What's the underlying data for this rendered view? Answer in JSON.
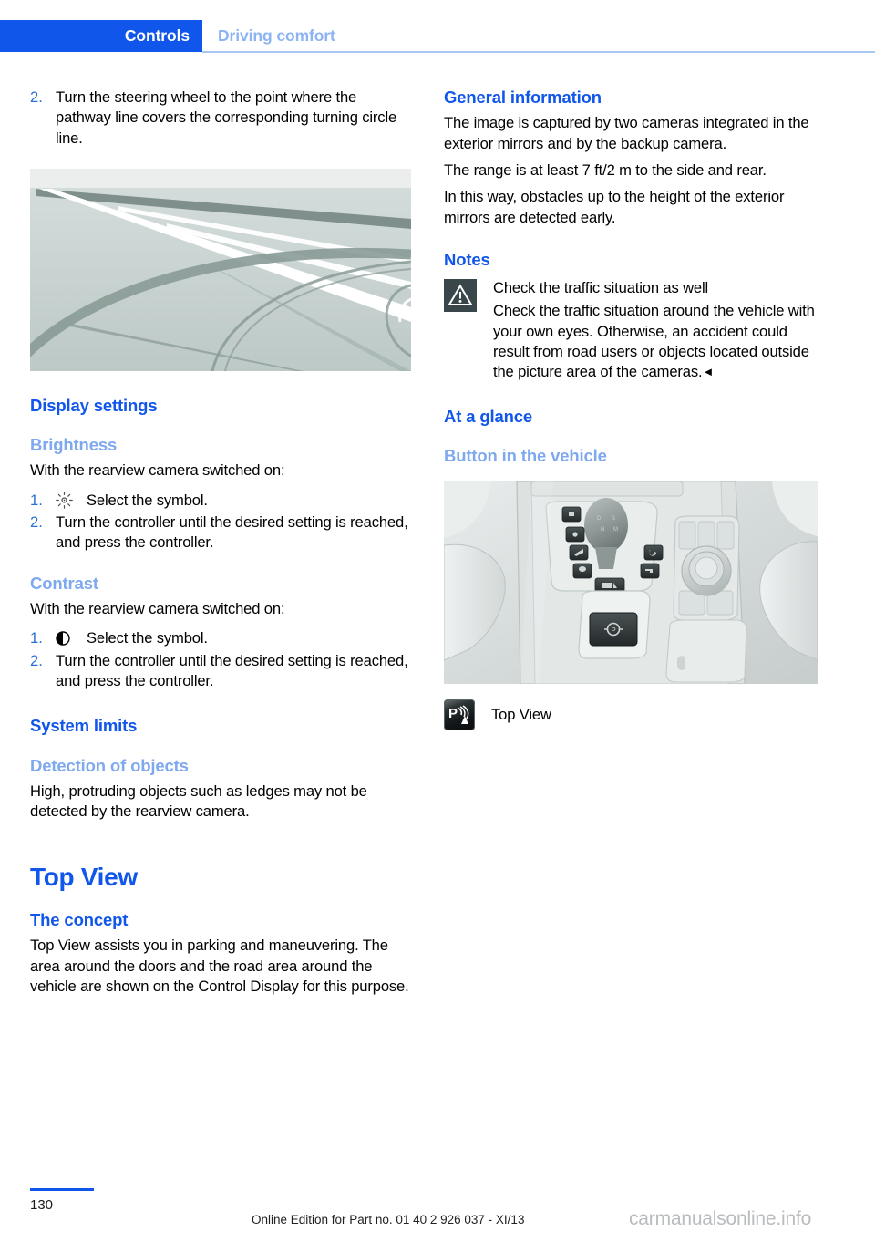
{
  "header": {
    "active_tab": "Controls",
    "inactive_tab": "Driving comfort",
    "accent_color": "#1156eb",
    "inactive_color": "#8cb4f5"
  },
  "left_column": {
    "step_prev": {
      "number": "2.",
      "text": "Turn the steering wheel to the point where the pathway line covers the corresponding turning circle line."
    },
    "figure_road": {
      "caption": "",
      "alt_name": "pathway-line-turning-circle-illustration"
    },
    "display_settings": {
      "heading": "Display settings",
      "brightness": {
        "heading": "Brightness",
        "intro": "With the rearview camera switched on:",
        "steps": [
          {
            "number": "1.",
            "symbol": "brightness-icon",
            "text": "Select the symbol."
          },
          {
            "number": "2.",
            "symbol": "",
            "text": "Turn the controller until the desired setting is reached, and press the controller."
          }
        ]
      },
      "contrast": {
        "heading": "Contrast",
        "intro": "With the rearview camera switched on:",
        "steps": [
          {
            "number": "1.",
            "symbol": "contrast-icon",
            "text": "Select the symbol."
          },
          {
            "number": "2.",
            "symbol": "",
            "text": "Turn the controller until the desired setting is reached, and press the controller."
          }
        ]
      }
    },
    "system_limits": {
      "heading": "System limits",
      "detection": {
        "heading": "Detection of objects",
        "text": "High, protruding objects such as ledges may not be detected by the rearview camera."
      }
    },
    "top_view": {
      "title": "Top View",
      "concept_heading": "The concept",
      "concept_text": "Top View assists you in parking and maneuvering. The area around the doors and the road area around the vehicle are shown on the Control Display for this purpose."
    }
  },
  "right_column": {
    "general_information": {
      "heading": "General information",
      "paragraphs": [
        "The image is captured by two cameras integrated in the exterior mirrors and by the backup camera.",
        "The range is at least 7 ft/2 m to the side and rear.",
        "In this way, obstacles up to the height of the exterior mirrors are detected early."
      ]
    },
    "notes": {
      "heading": "Notes",
      "warning_icon": "warning-triangle-icon",
      "title": "Check the traffic situation as well",
      "body": "Check the traffic situation around the vehicle with your own eyes. Otherwise, an accident could result from road users or objects located outside the picture area of the cameras.",
      "end_mark": "◄",
      "icon_color": "#39474a"
    },
    "at_a_glance": {
      "heading": "At a glance",
      "button_heading": "Button in the vehicle",
      "figure": {
        "alt_name": "center-console-photo"
      },
      "legend": {
        "icon": "top-view-button-icon",
        "label": "Top View"
      }
    }
  },
  "footer": {
    "page_number": "130",
    "edition": "Online Edition for Part no. 01 40 2 926 037 - XI/13",
    "watermark": "carmanualsonline.info"
  }
}
